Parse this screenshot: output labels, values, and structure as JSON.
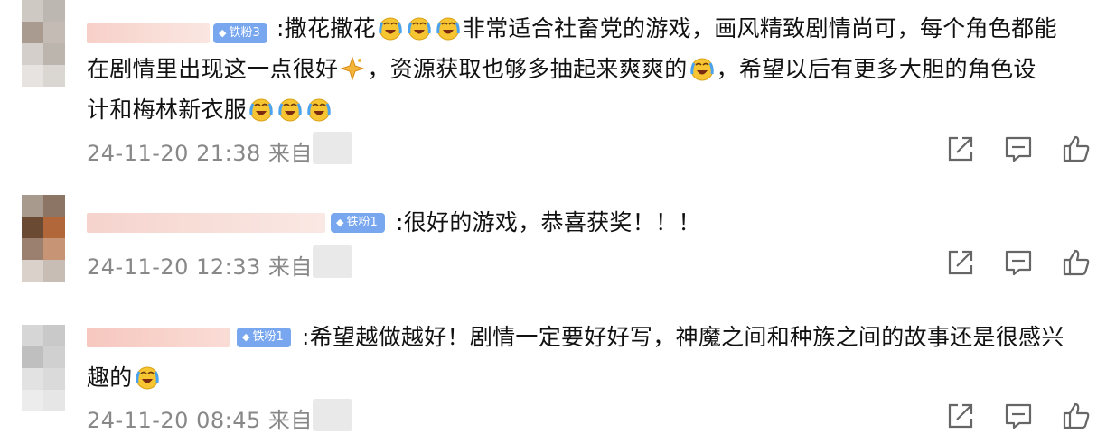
{
  "comments": [
    {
      "badge": "铁粉3",
      "lines": [
        ":撒花撒花",
        "非常适合社畜党的游戏，画风精致剧情尚可，每个角色都能",
        "在剧情里出现这一点很好",
        "，资源获取也够多抽起来爽爽的",
        "，希望以后有更多大胆的角色设",
        "计和梅林新衣服"
      ],
      "time": "24-11-20 21:38",
      "source": "来自"
    },
    {
      "badge": "铁粉1",
      "lines": [
        ":很好的游戏，恭喜获奖！！！"
      ],
      "time": "24-11-20 12:33",
      "source": "来自"
    },
    {
      "badge": "铁粉1",
      "lines": [
        ":希望越做越好！剧情一定要好好写，神魔之间和种族之间的故事还是很感兴",
        "趣的"
      ],
      "time": "24-11-20 08:45",
      "source": "来自"
    }
  ],
  "badge_icon": "diamond-icon",
  "emoji_icon": "crying-laughing-emoji-icon",
  "sparkle_icon": "sparkle-emoji-icon",
  "action_icons": [
    "share-icon",
    "comment-icon",
    "like-icon"
  ],
  "colors": {
    "badge": "#79a7ef",
    "text": "#111111",
    "meta": "#888888",
    "icon": "#666666"
  }
}
